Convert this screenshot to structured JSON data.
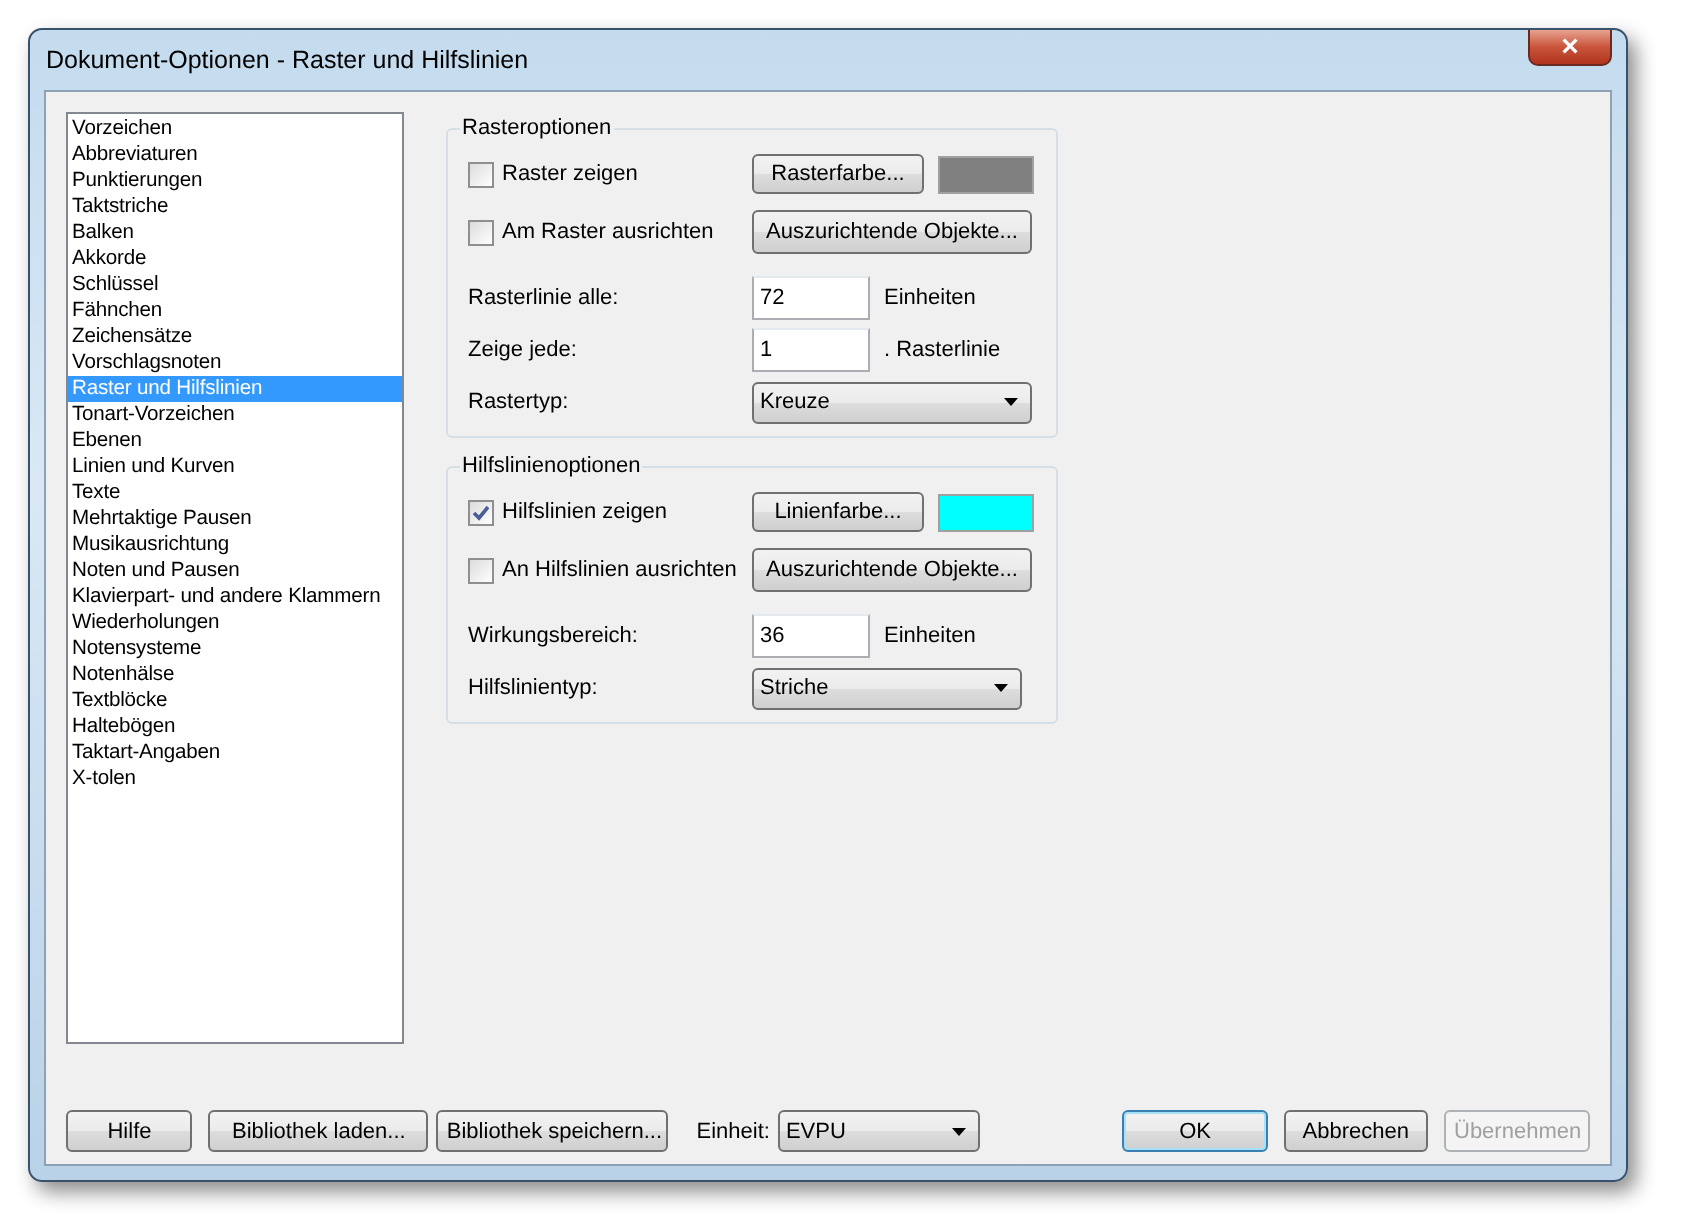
{
  "window": {
    "title": "Dokument-Optionen - Raster und Hilfslinien",
    "close": "×"
  },
  "categories": [
    {
      "label": "Vorzeichen",
      "selected": false
    },
    {
      "label": "Abbreviaturen",
      "selected": false
    },
    {
      "label": "Punktierungen",
      "selected": false
    },
    {
      "label": "Taktstriche",
      "selected": false
    },
    {
      "label": "Balken",
      "selected": false
    },
    {
      "label": "Akkorde",
      "selected": false
    },
    {
      "label": "Schlüssel",
      "selected": false
    },
    {
      "label": "Fähnchen",
      "selected": false
    },
    {
      "label": "Zeichensätze",
      "selected": false
    },
    {
      "label": "Vorschlagsnoten",
      "selected": false
    },
    {
      "label": "Raster und Hilfslinien",
      "selected": true
    },
    {
      "label": "Tonart-Vorzeichen",
      "selected": false
    },
    {
      "label": "Ebenen",
      "selected": false
    },
    {
      "label": "Linien und Kurven",
      "selected": false
    },
    {
      "label": "Texte",
      "selected": false
    },
    {
      "label": "Mehrtaktige Pausen",
      "selected": false
    },
    {
      "label": "Musikausrichtung",
      "selected": false
    },
    {
      "label": "Noten und Pausen",
      "selected": false
    },
    {
      "label": "Klavierpart- und andere Klammern",
      "selected": false
    },
    {
      "label": "Wiederholungen",
      "selected": false
    },
    {
      "label": "Notensysteme",
      "selected": false
    },
    {
      "label": "Notenhälse",
      "selected": false
    },
    {
      "label": "Textblöcke",
      "selected": false
    },
    {
      "label": "Haltebögen",
      "selected": false
    },
    {
      "label": "Taktart-Angaben",
      "selected": false
    },
    {
      "label": "X-tolen",
      "selected": false
    }
  ],
  "groups": [
    {
      "title": "Rasteroptionen",
      "show": {
        "label": "Raster zeigen",
        "checked": false
      },
      "color_button": "Rasterfarbe...",
      "color": "#808080",
      "snap": {
        "label": "Am Raster ausrichten",
        "checked": false
      },
      "snap_button": "Auszurichtende Objekte...",
      "fields": [
        {
          "label": "Rasterlinie alle:",
          "value": "72",
          "unit": "Einheiten"
        },
        {
          "label": "Zeige jede:",
          "value": "1",
          "unit": ". Rasterlinie"
        }
      ],
      "type": {
        "label": "Rastertyp:",
        "value": "Kreuze"
      }
    },
    {
      "title": "Hilfslinienoptionen",
      "show": {
        "label": "Hilfslinien zeigen",
        "checked": true
      },
      "color_button": "Linienfarbe...",
      "color": "#00ffff",
      "snap": {
        "label": "An Hilfslinien ausrichten",
        "checked": false
      },
      "snap_button": "Auszurichtende Objekte...",
      "fields": [
        {
          "label": "Wirkungsbereich:",
          "value": "36",
          "unit": "Einheiten"
        }
      ],
      "type": {
        "label": "Hilfslinientyp:",
        "value": "Striche"
      }
    }
  ],
  "left_buttons": [
    "Hilfe",
    "Bibliothek laden...",
    "Bibliothek speichern..."
  ],
  "unit": {
    "label": "Einheit:",
    "value": "EVPU"
  },
  "right_buttons": [
    {
      "label": "OK",
      "default": true,
      "disabled": false
    },
    {
      "label": "Abbrechen",
      "default": false,
      "disabled": false
    },
    {
      "label": "Übernehmen",
      "default": false,
      "disabled": true
    }
  ]
}
